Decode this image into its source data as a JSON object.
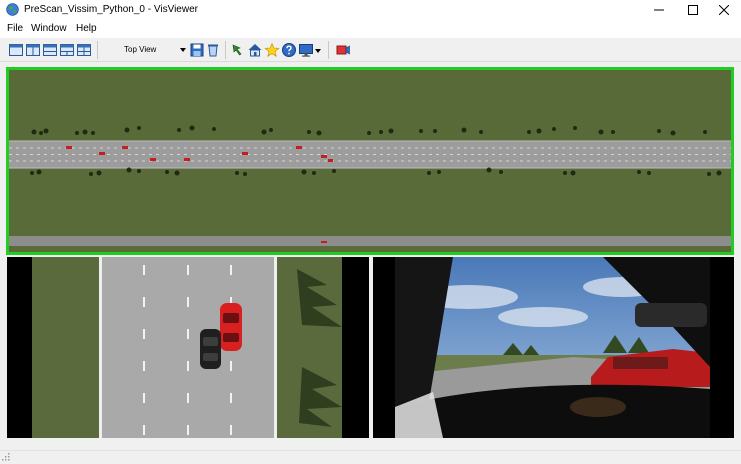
{
  "window": {
    "title": "PreScan_Vissim_Python_0 - VisViewer",
    "app_icon": "globe-icon",
    "controls": [
      "minimize-icon",
      "maximize-icon",
      "close-icon"
    ]
  },
  "menu": [
    "File",
    "Window",
    "Help"
  ],
  "toolbar": {
    "layout_buttons": [
      "layout-single-icon",
      "layout-two-columns-icon",
      "layout-two-rows-icon",
      "layout-three-icon",
      "layout-four-icon"
    ],
    "view_select": "Top View",
    "tools": [
      "save-icon",
      "delete-icon",
      "pick-icon",
      "home-icon",
      "star-icon",
      "help-icon",
      "screen-icon",
      "record-icon"
    ]
  },
  "viewports": [
    {
      "name": "top-view",
      "active": true
    },
    {
      "name": "follow-view",
      "active": false
    },
    {
      "name": "driver-view",
      "active": false
    }
  ],
  "colors": {
    "active_border": "#22cc22",
    "grass": "#5a6b3a",
    "road": "#9b9b9b",
    "ego_car": "#d82020",
    "other_car": "#222222"
  }
}
